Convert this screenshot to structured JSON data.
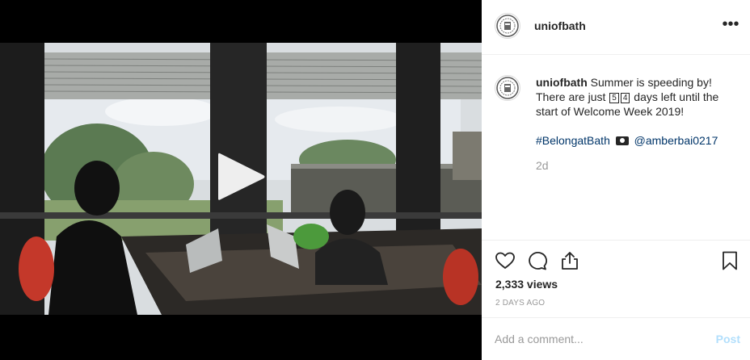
{
  "post": {
    "username": "uniofbath",
    "caption_prefix": "Summer is speeding by! There are just",
    "days_digits": [
      "5",
      "4"
    ],
    "caption_suffix": "days left until the start of Welcome Week 2019!",
    "hashtag": "#BelongatBath",
    "mention": "@amberbai0217",
    "age": "2d",
    "views": "2,333 views",
    "date": "2 DAYS AGO"
  },
  "comment_box": {
    "placeholder": "Add a comment...",
    "post_label": "Post"
  },
  "icons": {
    "more": "more-options-icon",
    "like": "heart-icon",
    "comment": "comment-bubble-icon",
    "share": "share-icon",
    "save": "bookmark-icon",
    "play": "play-icon",
    "avatar": "university-crest-icon"
  },
  "colors": {
    "link": "#003569",
    "muted": "#999999",
    "post_disabled": "#b2dffc",
    "video_bg": "#000000"
  }
}
